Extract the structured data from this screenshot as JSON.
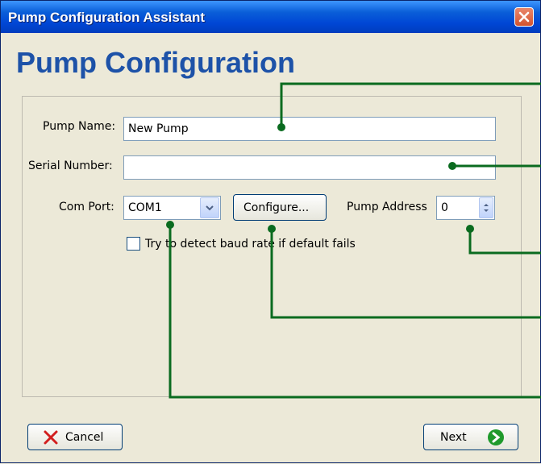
{
  "window": {
    "title": "Pump Configuration Assistant"
  },
  "heading": "Pump Configuration",
  "form": {
    "pump_name_label": "Pump Name:",
    "pump_name_value": "New Pump",
    "serial_number_label": "Serial Number:",
    "serial_number_value": "",
    "com_port_label": "Com Port:",
    "com_port_value": "COM1",
    "configure_label": "Configure...",
    "pump_address_label": "Pump Address",
    "pump_address_value": "0",
    "baud_checkbox_label": "Try to detect baud rate if default fails",
    "baud_checkbox_checked": false
  },
  "buttons": {
    "cancel_label": "Cancel",
    "next_label": "Next"
  },
  "icons": {
    "close": "close-icon",
    "cancel": "red-x-icon",
    "next": "green-arrow-icon",
    "combo": "chevron-down-icon",
    "spinner": "up-down-arrows-icon"
  },
  "colors": {
    "title_bar": "#0046d5",
    "heading": "#1d52a8",
    "callout": "#0a6b1f",
    "close": "#d4532e",
    "window_bg": "#ece9d8"
  }
}
